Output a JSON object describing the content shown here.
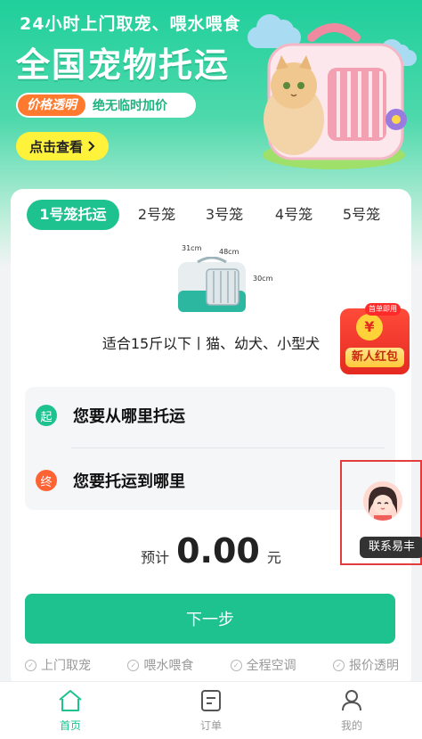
{
  "hero": {
    "subtitle": "24小时上门取宠、喂水喂食",
    "title": "全国宠物托运",
    "price_tag": "价格透明",
    "price_text": "绝无临时加价",
    "cta_label": "点击查看"
  },
  "tabs": [
    {
      "label": "1号笼托运",
      "active": true
    },
    {
      "label": "2号笼",
      "active": false
    },
    {
      "label": "3号笼",
      "active": false
    },
    {
      "label": "4号笼",
      "active": false
    },
    {
      "label": "5号笼",
      "active": false
    }
  ],
  "crate": {
    "dim_w": "31cm",
    "dim_d": "48cm",
    "dim_h": "30cm",
    "fit_text": "适合15斤以下丨猫、幼犬、小型犬"
  },
  "route": {
    "start_badge": "起",
    "start_label": "您要从哪里托运",
    "end_badge": "终",
    "end_label": "您要托运到哪里"
  },
  "estimate": {
    "prefix": "预计",
    "amount": "0.00",
    "unit": "元"
  },
  "next_button": "下一步",
  "features": [
    "上门取宠",
    "喂水喂食",
    "全程空调",
    "报价透明"
  ],
  "red_packet": {
    "ribbon": "首单即用",
    "coin": "¥",
    "label": "新人红包"
  },
  "contact": {
    "label": "联系易丰"
  },
  "nav": {
    "home": "首页",
    "orders": "订单",
    "mine": "我的"
  },
  "colors": {
    "brand": "#1ec28f",
    "accent_orange": "#ff6233",
    "cta_yellow": "#fff23a"
  }
}
